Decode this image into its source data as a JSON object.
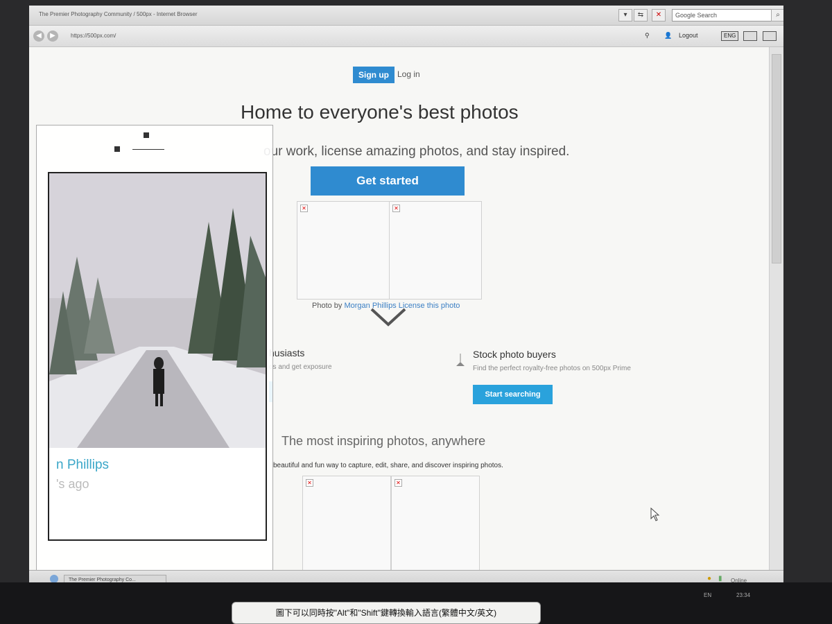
{
  "browser": {
    "window_title": "The Premier Photography Community / 500px - Internet Browser",
    "url": "https://500px.com/",
    "search_placeholder": "Google Search",
    "logout_label": "Logout",
    "lang_label": "ENG"
  },
  "header": {
    "signup_label": "Sign up",
    "login_label": "Log in"
  },
  "hero": {
    "title": "Home to everyone's best photos",
    "subtitle": "our work, license amazing photos, and stay inspired.",
    "cta_label": "Get started"
  },
  "credit": {
    "prefix": "Photo by",
    "author": "Morgan Phillips",
    "license": "License this photo"
  },
  "audiences": {
    "left": {
      "title": "husiasts",
      "subtitle": "os and get exposure"
    },
    "right": {
      "title": "Stock photo buyers",
      "subtitle": "Find the perfect royalty-free photos on 500px Prime",
      "button": "Start searching"
    }
  },
  "inspiring": {
    "title": "The most inspiring photos, anywhere",
    "subtitle": "beautiful and fun way to capture, edit, share, and discover inspiring photos."
  },
  "overlay_card": {
    "name": "n Phillips",
    "time": "'s ago"
  },
  "taskbar": {
    "item_label": "The Premier Photography Co...",
    "status": "Online",
    "lang": "EN",
    "clock": "23:34"
  },
  "sticker": {
    "text": "圖下可以同時按\"Alt\"和\"Shift\"鍵轉換輸入語言(繁體中文/英文)"
  }
}
